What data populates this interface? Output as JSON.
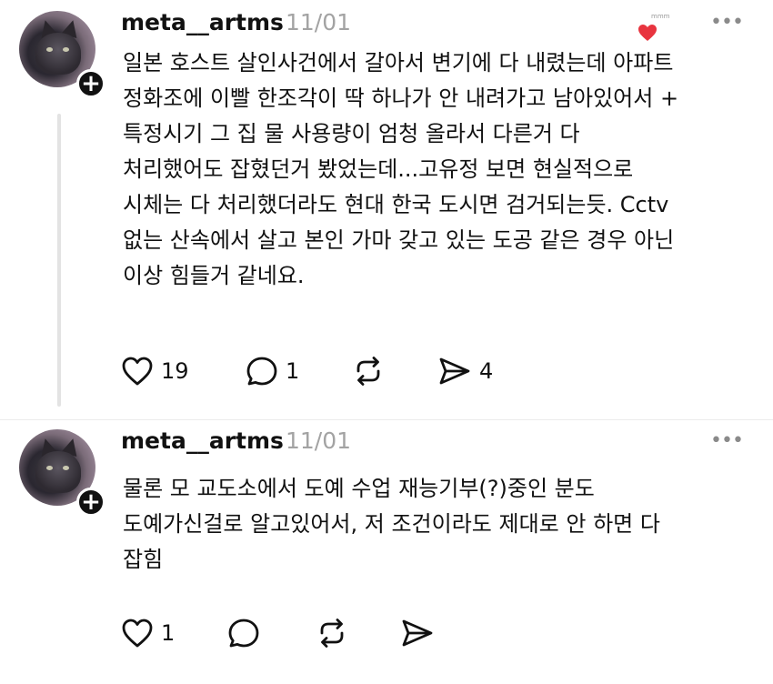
{
  "posts": [
    {
      "username": "meta__artms",
      "date": "11/01",
      "body": "일본 호스트 살인사건에서 갈아서 변기에 다 내렸는데 아파트\n정화조에 이빨 한조각이 딱 하나가 안 내려가고 남아있어서 +\n특정시기 그 집 물 사용량이 엄청 올라서 다른거 다\n처리했어도 잡혔던거 봤었는데...고유정 보면 현실적으로\n시체는 다 처리했더라도 현대 한국 도시면 검거되는듯. Cctv\n없는 산속에서 살고 본인 가마 갖고 있는 도공 같은 경우 아닌\n이상 힘들거 같네요.",
      "likes": "19",
      "replies": "1",
      "reposts": "",
      "shares": "4"
    },
    {
      "username": "meta__artms",
      "date": "11/01",
      "body": "물론 모 교도소에서 도예 수업 재능기부(?)중인 분도\n도예가신걸로 알고있어서, 저 조건이라도 제대로 안 하면 다\n잡힘",
      "likes": "1",
      "replies": "",
      "reposts": "",
      "shares": ""
    }
  ],
  "overlay": {
    "notif_text": "mmm"
  },
  "icons": {
    "like": "heart-outline-icon",
    "reply": "speech-bubble-icon",
    "repost": "repost-arrows-icon",
    "share": "send-arrow-icon",
    "more": "more-dots-icon",
    "follow": "plus-icon"
  },
  "colors": {
    "accent_heart": "#e8343f",
    "muted": "#a3a3a3",
    "text": "#111111"
  }
}
